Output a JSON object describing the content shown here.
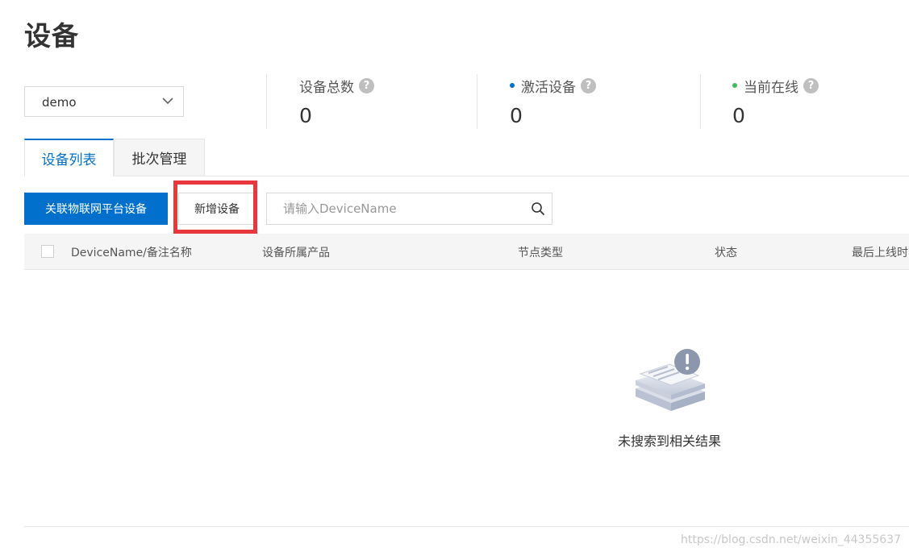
{
  "page": {
    "title": "设备"
  },
  "product_select": {
    "value": "demo"
  },
  "stats": [
    {
      "label": "设备总数",
      "value": "0",
      "dot_color": ""
    },
    {
      "label": "激活设备",
      "value": "0",
      "dot_color": "#0070cc"
    },
    {
      "label": "当前在线",
      "value": "0",
      "dot_color": "#3fbb5a"
    }
  ],
  "help_glyph": "?",
  "tabs": [
    {
      "label": "设备列表",
      "active": true
    },
    {
      "label": "批次管理",
      "active": false
    }
  ],
  "toolbar": {
    "link_button_label": "关联物联网平台设备",
    "add_button_label": "新增设备",
    "search_placeholder": "请输入DeviceName"
  },
  "table": {
    "columns": [
      "DeviceName/备注名称",
      "设备所属产品",
      "节点类型",
      "状态",
      "最后上线时间"
    ]
  },
  "empty_state": {
    "message": "未搜索到相关结果"
  },
  "watermark": "https://blog.csdn.net/weixin_44355637",
  "colors": {
    "primary": "#0070cc",
    "highlight": "#e8383d",
    "online": "#3fbb5a"
  }
}
